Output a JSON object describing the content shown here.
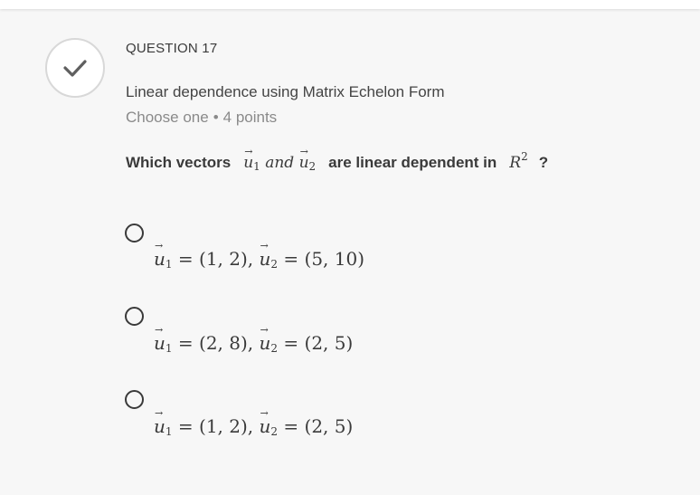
{
  "question": {
    "number_label": "QUESTION 17",
    "title": "Linear dependence using Matrix Echelon Form",
    "type": "Choose one",
    "separator": "•",
    "points": "4 points",
    "prompt": {
      "lead": "Which vectors",
      "vec1_base": "u",
      "vec1_sub": "1",
      "and_word": "and",
      "vec2_base": "u",
      "vec2_sub": "2",
      "middle": "are linear dependent  in",
      "space_base": "R",
      "space_sup": "2",
      "tail": "?"
    },
    "status_icon": "checkmark-icon"
  },
  "options": [
    {
      "u1": "(1, 2)",
      "u2": "(5, 10)",
      "selected": false
    },
    {
      "u1": "(2, 8)",
      "u2": "(2, 5)",
      "selected": false
    },
    {
      "u1": "(1, 2)",
      "u2": "(2, 5)",
      "selected": false
    }
  ],
  "math_symbols": {
    "u": "u",
    "sub1": "1",
    "sub2": "2",
    "equals": "=",
    "comma": ","
  },
  "colors": {
    "background": "#f7f7f7",
    "text": "#3a3a3a",
    "muted": "#8a8a8a",
    "check_stroke": "#5f5f5f",
    "circle_border": "#d8d8d8"
  }
}
